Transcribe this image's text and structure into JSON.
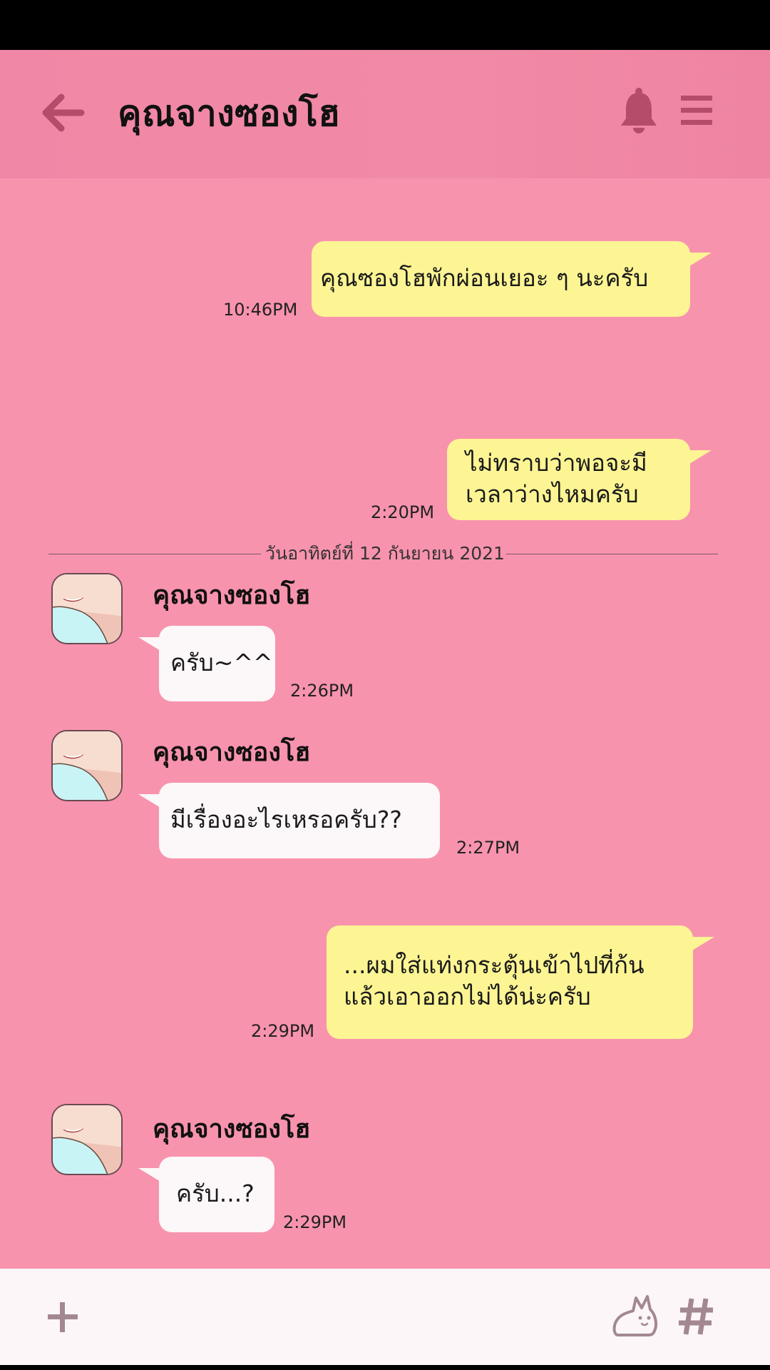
{
  "header": {
    "title": "คุณจางซองโฮ"
  },
  "colors": {
    "header_bg": "#f087a6",
    "chat_bg": "#f893ad",
    "outgoing_bubble": "#fdf594",
    "incoming_bubble": "#fcf7f8",
    "input_bar_bg": "#fcf6f8",
    "icon_color": "#b34d6a"
  },
  "date_separator": "วันอาทิตย์ที่ 12 กันยายน 2021",
  "messages": [
    {
      "direction": "out",
      "lines": [
        "คุณซองโฮพักผ่อนเยอะ ๆ นะครับ"
      ],
      "time": "10:46PM"
    },
    {
      "direction": "out",
      "lines": [
        "ไม่ทราบว่าพอจะมี",
        "เวลาว่างไหมครับ"
      ],
      "time": "2:20PM"
    },
    {
      "direction": "in",
      "sender": "คุณจางซองโฮ",
      "lines": [
        "ครับ~^^"
      ],
      "time": "2:26PM"
    },
    {
      "direction": "in",
      "sender": "คุณจางซองโฮ",
      "lines": [
        "มีเรื่องอะไรเหรอครับ??"
      ],
      "time": "2:27PM"
    },
    {
      "direction": "out",
      "lines": [
        "...ผมใส่แท่งกระตุ้นเข้าไปที่ก้น",
        "แล้วเอาออกไม่ได้น่ะครับ"
      ],
      "time": "2:29PM"
    },
    {
      "direction": "in",
      "sender": "คุณจางซองโฮ",
      "lines": [
        "ครับ...?"
      ],
      "time": "2:29PM"
    }
  ],
  "icons": {
    "back": "arrow-left-icon",
    "bell": "bell-icon",
    "menu": "menu-icon",
    "plus": "plus-icon",
    "sticker": "rabbit-sticker-icon",
    "hashtag": "hashtag-icon"
  }
}
